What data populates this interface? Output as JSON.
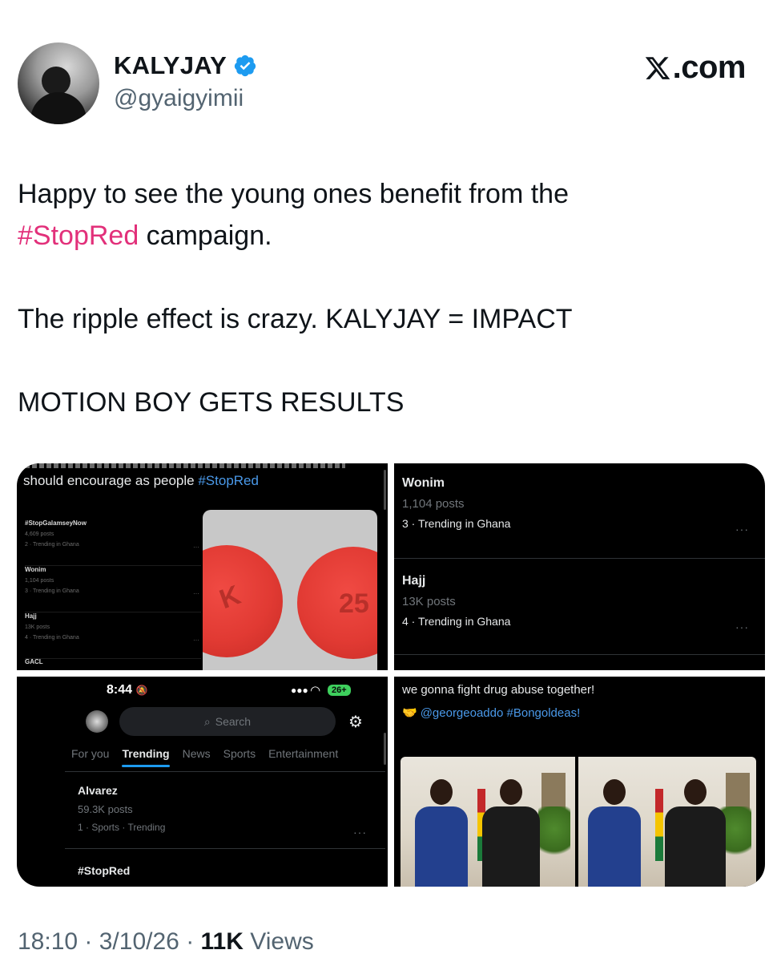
{
  "author": {
    "name": "KALYJAY",
    "handle": "@gyaigyimii",
    "verified": true
  },
  "brand": {
    "label": ".com",
    "icon": "x-logo-icon"
  },
  "tweet": {
    "line1": "Happy to see the young ones benefit from the",
    "hashtag": "#StopRed",
    "line2_rest": " campaign.",
    "line3": "The ripple effect is crazy. KALYJAY = IMPACT",
    "line4": "MOTION BOY GETS RESULTS"
  },
  "media": {
    "tile1": {
      "top_text": "should encourage as people ",
      "top_tag": "#StopRed",
      "mini_items": [
        {
          "title": "#StopGalamseyNow",
          "posts": "4,609 posts",
          "meta": "2 · Trending in Ghana"
        },
        {
          "title": "Wonim",
          "posts": "1,104 posts",
          "meta": "3 · Trending in Ghana"
        },
        {
          "title": "Hajj",
          "posts": "13K posts",
          "meta": "4 · Trending in Ghana"
        }
      ],
      "mini_bottom": "GACL",
      "pill_marks": [
        "K",
        "25"
      ]
    },
    "tile2": {
      "trends": [
        {
          "title": "Wonim",
          "posts": "1,104 posts",
          "meta": "3 · Trending in Ghana"
        },
        {
          "title": "Hajj",
          "posts": "13K posts",
          "meta": "4 · Trending in Ghana"
        }
      ],
      "dots": "···"
    },
    "tile3": {
      "time": "8:44",
      "bell": "🔕",
      "battery": "26+",
      "search_placeholder": "Search",
      "tabs": [
        "For you",
        "Trending",
        "News",
        "Sports",
        "Entertainment"
      ],
      "active_tab": "Trending",
      "trends": [
        {
          "title": "Alvarez",
          "posts": "59.3K posts",
          "meta": "1 · Sports · Trending"
        },
        {
          "title": "#StopRed"
        }
      ],
      "dots": "···"
    },
    "tile4": {
      "line1": "we gonna fight drug abuse together!",
      "hand": "🤝",
      "line2": "@georgeoaddo #Bongoldeas!"
    }
  },
  "footer": {
    "time": "18:10",
    "date": "3/10/26",
    "views_count": "11K",
    "views_label": "Views"
  },
  "colors": {
    "hashtag": "#e2307a",
    "verified": "#1d9bf0",
    "muted": "#536471"
  }
}
